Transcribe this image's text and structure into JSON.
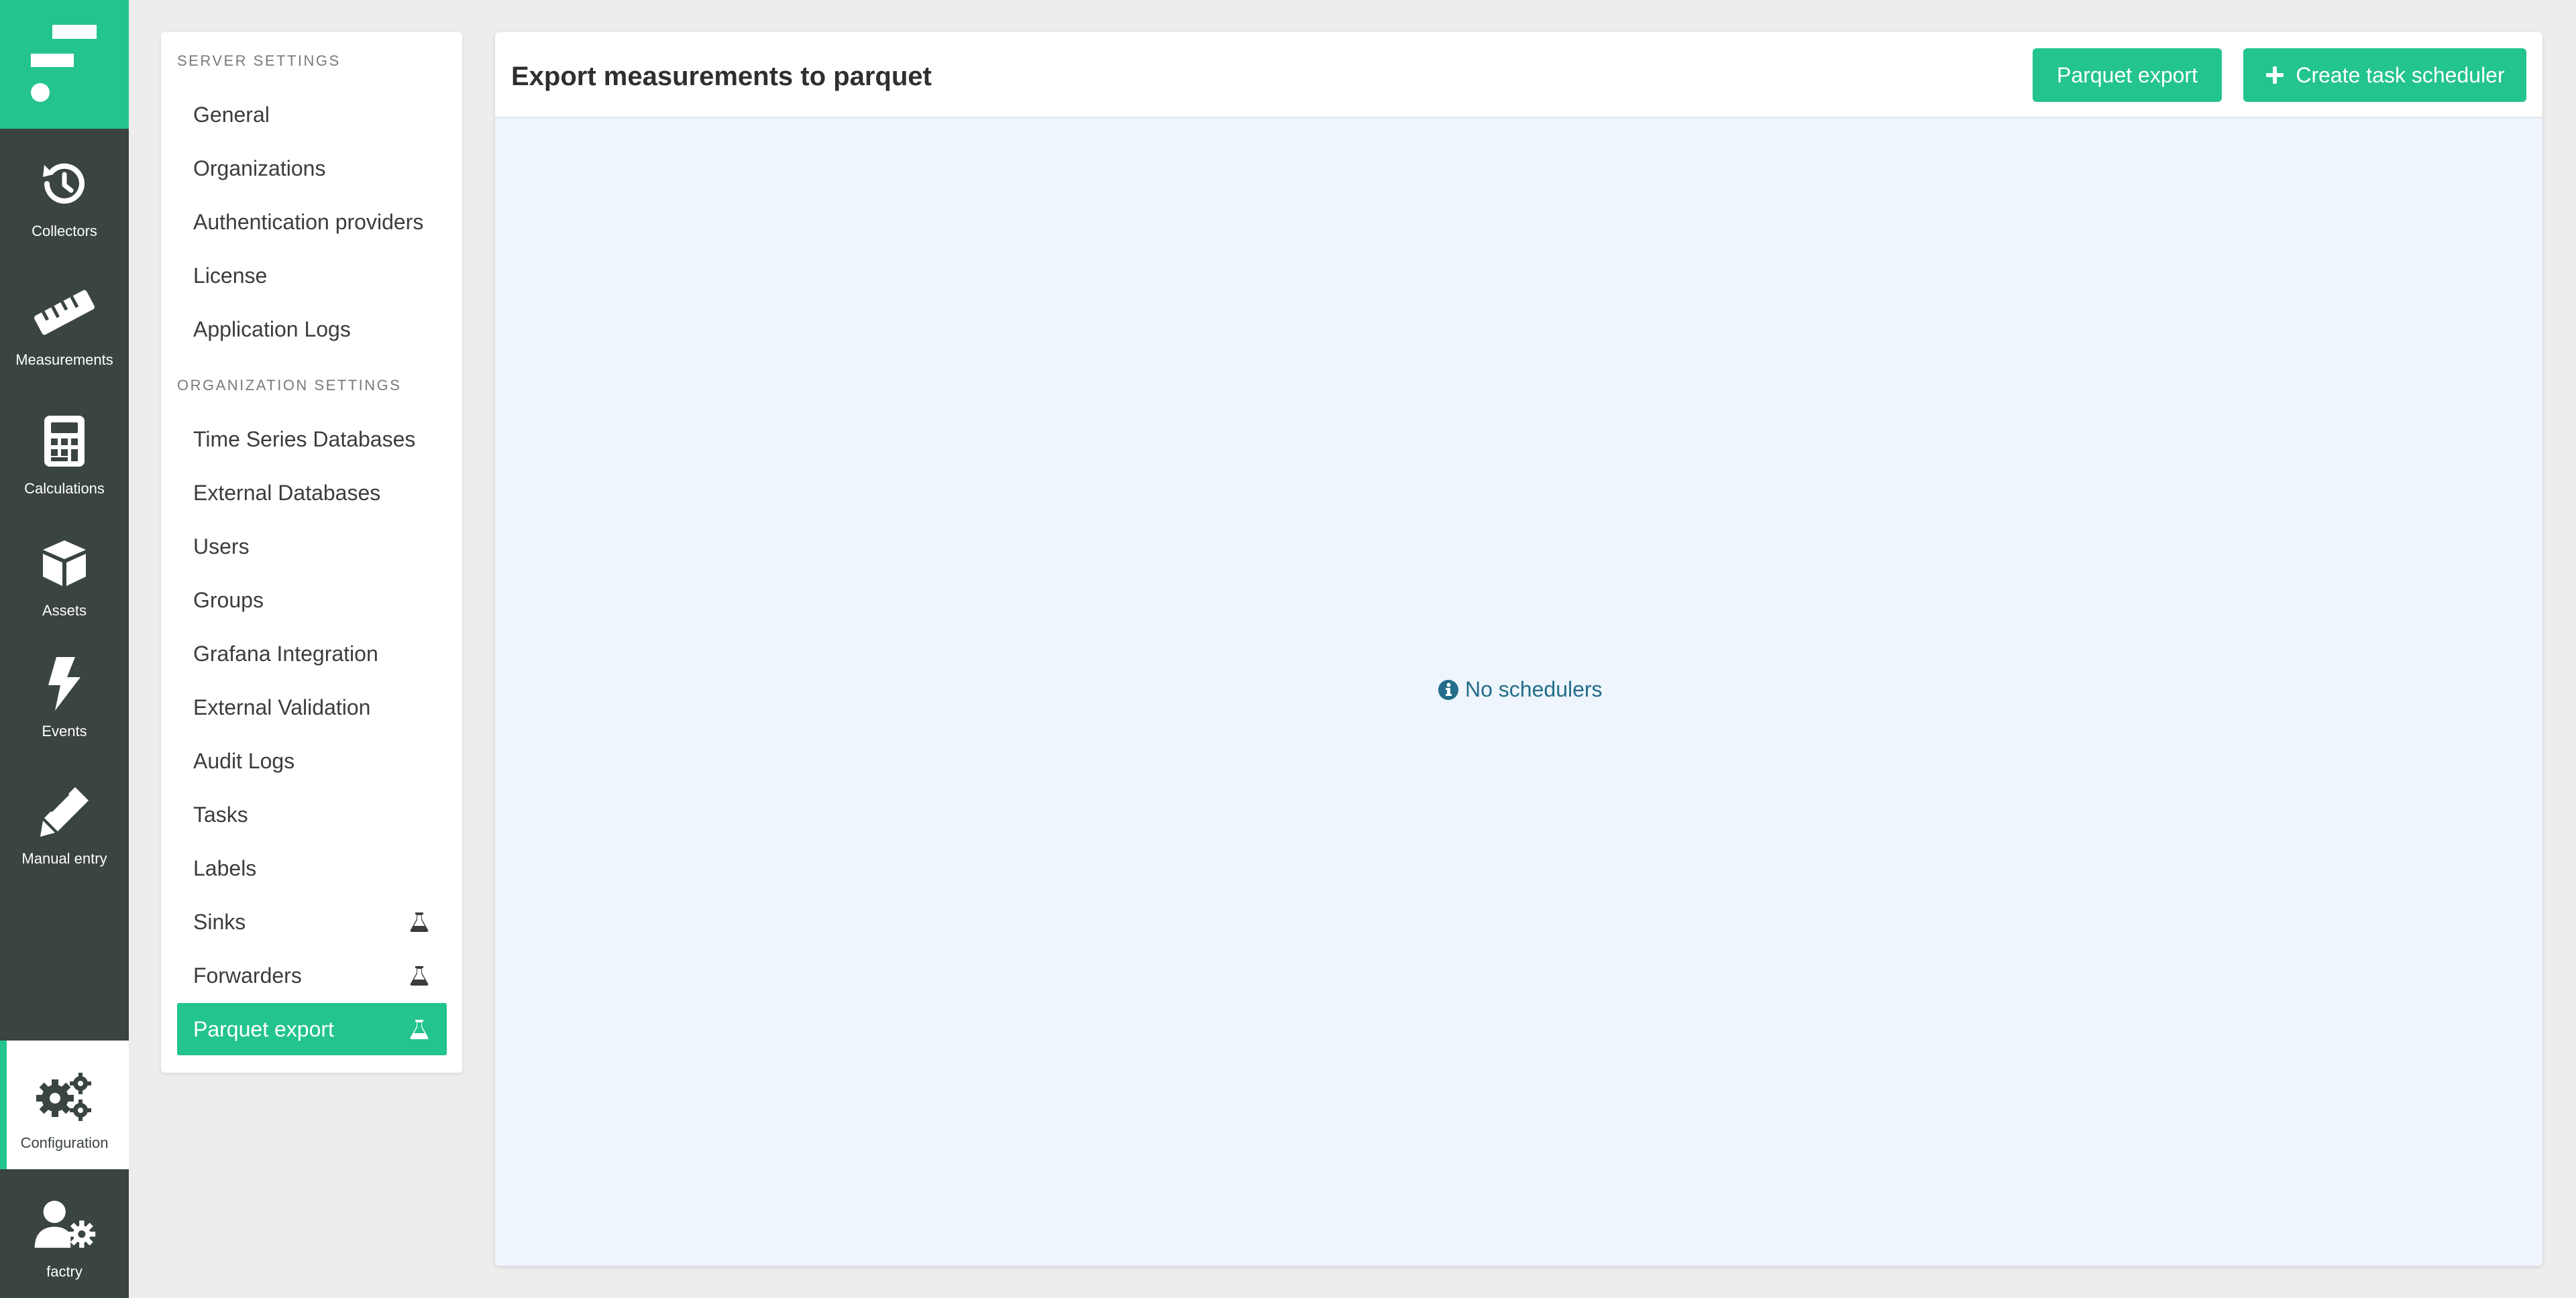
{
  "app": {
    "nav": [
      {
        "id": "collectors",
        "label": "Collectors",
        "icon": "history-icon"
      },
      {
        "id": "measurements",
        "label": "Measurements",
        "icon": "ruler-icon"
      },
      {
        "id": "calculations",
        "label": "Calculations",
        "icon": "calculator-icon"
      },
      {
        "id": "assets",
        "label": "Assets",
        "icon": "cube-icon"
      },
      {
        "id": "events",
        "label": "Events",
        "icon": "bolt-icon"
      },
      {
        "id": "manual_entry",
        "label": "Manual entry",
        "icon": "pen-icon"
      },
      {
        "id": "configuration",
        "label": "Configuration",
        "icon": "gears-icon",
        "active": true
      },
      {
        "id": "user",
        "label": "factry",
        "icon": "user-gear-icon"
      }
    ]
  },
  "settings_menu": {
    "server_section": "SERVER SETTINGS",
    "server_items": [
      {
        "label": "General"
      },
      {
        "label": "Organizations"
      },
      {
        "label": "Authentication providers"
      },
      {
        "label": "License"
      },
      {
        "label": "Application Logs"
      }
    ],
    "org_section": "ORGANIZATION SETTINGS",
    "org_items": [
      {
        "label": "Time Series Databases"
      },
      {
        "label": "External Databases"
      },
      {
        "label": "Users"
      },
      {
        "label": "Groups"
      },
      {
        "label": "Grafana Integration"
      },
      {
        "label": "External Validation"
      },
      {
        "label": "Audit Logs"
      },
      {
        "label": "Tasks"
      },
      {
        "label": "Labels"
      },
      {
        "label": "Sinks",
        "experimental": true
      },
      {
        "label": "Forwarders",
        "experimental": true
      },
      {
        "label": "Parquet export",
        "experimental": true,
        "active": true
      }
    ]
  },
  "main": {
    "title": "Export measurements to parquet",
    "parquet_export_button": "Parquet export",
    "create_scheduler_button": "Create task scheduler",
    "empty_message": "No schedulers"
  },
  "colors": {
    "accent": "#23c48e",
    "rail": "#3a4441",
    "panel_body": "#eef5fc",
    "info_text": "#236e8a"
  }
}
